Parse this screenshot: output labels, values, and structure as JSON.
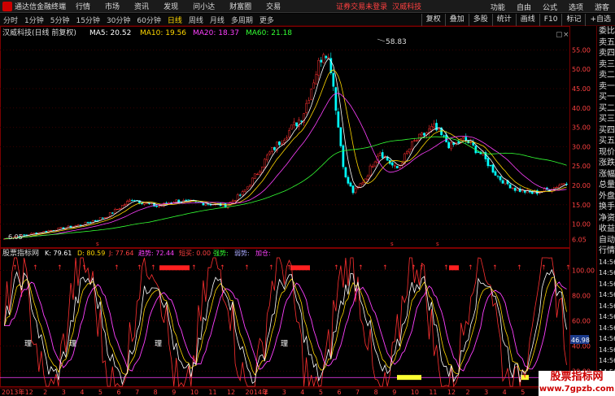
{
  "titlebar": {
    "app_title": "通达信金融终端",
    "menus": [
      "行情",
      "市场",
      "资讯",
      "发现",
      "问小达",
      "财富圈",
      "交易"
    ],
    "warning": "证券交易未登录",
    "stock_name": "汉威科技",
    "right_items": [
      "功能",
      "自由",
      "公式",
      "选项",
      "游客"
    ]
  },
  "periodbar": {
    "periods": [
      "分时",
      "1分钟",
      "5分钟",
      "15分钟",
      "30分钟",
      "60分钟",
      "日线",
      "周线",
      "月线",
      "多周期",
      "更多"
    ],
    "active": "日线",
    "tools": [
      "复权",
      "叠加",
      "多股",
      "统计",
      "画线",
      "F10",
      "标记",
      "+自选"
    ]
  },
  "main_panel": {
    "stock_label": "汉威科技(日线 前复权)",
    "ma": [
      {
        "label": "MA5: 20.52",
        "color": "#ffffff"
      },
      {
        "label": "MA10: 19.56",
        "color": "#ffd700"
      },
      {
        "label": "MA20: 18.37",
        "color": "#ff40ff"
      },
      {
        "label": "MA60: 21.18",
        "color": "#33ff33"
      }
    ],
    "y_ticks": [
      "55.00",
      "50.00",
      "45.00",
      "40.00",
      "35.00",
      "30.00",
      "25.00",
      "20.00",
      "15.00",
      "10.00",
      "6.05"
    ],
    "peak_label": "58.83",
    "low_label": "6.05"
  },
  "indicator_panel": {
    "name": "股票指标网",
    "items": [
      {
        "label": "K: 79.61",
        "color": "#ffffff"
      },
      {
        "label": "D: 80.59",
        "color": "#ffd700"
      },
      {
        "label": "J: 77.64",
        "color": "#ff4040"
      },
      {
        "label": "趋势: 72.44",
        "color": "#ff40ff"
      },
      {
        "label": "短买: 0.00",
        "color": "#ff4040"
      },
      {
        "label": "强势:",
        "color": "#33ff33"
      },
      {
        "label": "弱势:",
        "color": "#aaaaff"
      },
      {
        "label": "加仓:",
        "color": "#ff40ff"
      }
    ],
    "y_ticks": [
      "100.00",
      "80.00",
      "60.00",
      "40.00",
      "20.00"
    ],
    "current_value": "46.98",
    "marker_char": "理"
  },
  "x_axis": {
    "labels": [
      "2013年",
      "12",
      "2",
      "3",
      "4",
      "5",
      "6",
      "7",
      "8",
      "9",
      "10",
      "11",
      "12",
      "2014年",
      "2",
      "3",
      "4",
      "5",
      "6",
      "7",
      "8",
      "9",
      "10",
      "11",
      "12",
      "2",
      "3",
      "4",
      "5",
      "6",
      "7"
    ]
  },
  "side_panel": {
    "items": [
      "委比",
      "卖五",
      "卖四",
      "卖三",
      "卖二",
      "卖一",
      "买一",
      "买二",
      "买三",
      "买四",
      "买五",
      "现价",
      "涨跌",
      "涨幅",
      "总量",
      "外盘",
      "换手",
      "净资",
      "收益",
      "自动",
      "行情",
      "14:56",
      "14:56",
      "14:56",
      "14:56",
      "14:56",
      "14:56",
      "14:56",
      "14:56",
      "14:56",
      "14:56",
      "14:56",
      "14:56"
    ]
  },
  "watermark": {
    "line1": "股票指标网",
    "line2": "www.7gpzb.com"
  },
  "colors": {
    "up": "#ff3030",
    "down": "#00ffff",
    "grid": "#7a0000",
    "axis_text": "#ff4040"
  }
}
